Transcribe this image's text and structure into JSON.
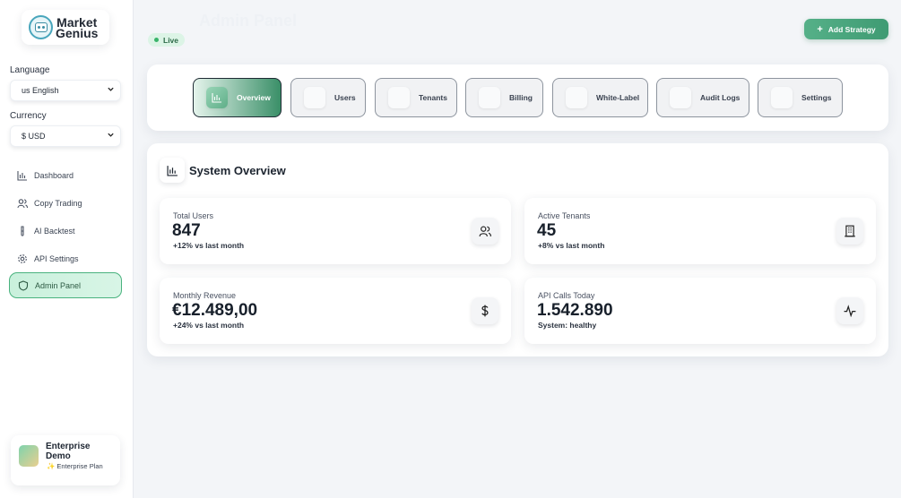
{
  "brand": {
    "line1": "Market",
    "line2": "Genius"
  },
  "sidebar": {
    "language_label": "Language",
    "language_value": "us English",
    "currency_label": "Currency",
    "currency_value": "$ USD",
    "items": [
      {
        "label": "Dashboard",
        "icon": "bar-chart-icon"
      },
      {
        "label": "Copy Trading",
        "icon": "users-icon"
      },
      {
        "label": "AI Backtest",
        "icon": "test-tube-icon"
      },
      {
        "label": "API Settings",
        "icon": "gear-icon"
      },
      {
        "label": "Admin Panel",
        "icon": "shield-icon",
        "active": true
      }
    ]
  },
  "user": {
    "name": "Enterprise Demo",
    "plan": "✨ Enterprise Plan"
  },
  "header": {
    "title": "Admin Panel",
    "status": "Live",
    "add_button": "Add Strategy"
  },
  "tabs": [
    {
      "label": "Overview",
      "icon": "bar-chart-icon",
      "active": true
    },
    {
      "label": "Users",
      "icon": "users-icon"
    },
    {
      "label": "Tenants",
      "icon": "building-icon"
    },
    {
      "label": "Billing",
      "icon": "credit-card-icon"
    },
    {
      "label": "White-Label",
      "icon": "palette-icon"
    },
    {
      "label": "Audit Logs",
      "icon": "log-icon"
    },
    {
      "label": "Settings",
      "icon": "gear-icon"
    }
  ],
  "overview": {
    "title": "System Overview",
    "stats": [
      {
        "label": "Total Users",
        "value": "847",
        "sub": "+12% vs last month",
        "icon": "users-icon"
      },
      {
        "label": "Active Tenants",
        "value": "45",
        "sub": "+8% vs last month",
        "icon": "building-icon"
      },
      {
        "label": "Monthly Revenue",
        "value": "€12.489,00",
        "sub": "+24% vs last month",
        "icon": "dollar-icon"
      },
      {
        "label": "API Calls Today",
        "value": "1.542.890",
        "sub": "System: healthy",
        "icon": "activity-icon"
      }
    ]
  },
  "colors": {
    "accent": "#3f9b73",
    "live": "#39b46a",
    "active_nav": "#c9f0dc"
  }
}
